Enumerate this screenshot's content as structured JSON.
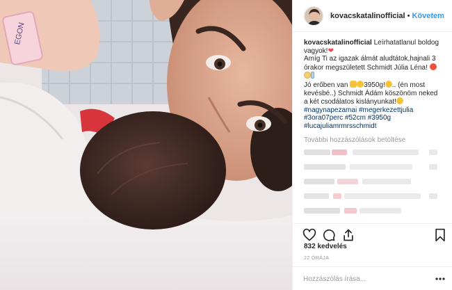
{
  "post": {
    "photo_alt": "",
    "header": {
      "username": "kovacskatalinofficial",
      "separator": "•",
      "follow_label": "Követem"
    },
    "caption": {
      "username": "kovacskatalinofficial",
      "line1": " Leírhatatlanul boldog vagyok!",
      "line2": "Amíg Ti az igazak álmát aludtátok,hajnali 3 órakor megszületett Schmidt Júlia Léna! ",
      "line3": "Jó erőben van",
      "line3b": "3950g!",
      "line3c": ".. (én most kevésbé..) Schmidt Ádám köszönöm neked a két csodálatos kislányunkat!",
      "tags": [
        "#nagynapezamai",
        "#megerkezettjulia",
        "#3ora07perc",
        "#52cm",
        "#3950g",
        "#lucajuliamrmrsschmidt"
      ]
    },
    "load_more_label": "További hozzászólások betöltése",
    "likes_label": "832 kedvelés",
    "time_label": "22 ÓRÁJA",
    "comment_placeholder": "Hozzászólás írása...",
    "icons": [
      "heart-icon",
      "comment-icon",
      "share-icon",
      "bookmark-icon",
      "more-icon"
    ],
    "colors": {
      "link": "#3897f0",
      "hashtag": "#003569",
      "muted": "#999999",
      "text": "#262626",
      "border": "#efefef",
      "heart": "#ed4956"
    }
  }
}
